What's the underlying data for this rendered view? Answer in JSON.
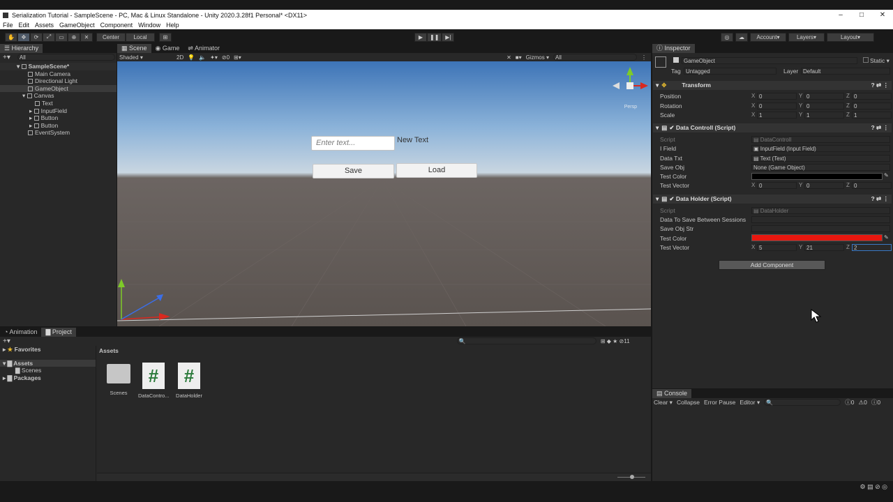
{
  "window": {
    "title": "Serialization Tutorial - SampleScene - PC, Mac & Linux Standalone - Unity 2020.3.28f1 Personal* <DX11>",
    "min": "–",
    "max": "□",
    "close": "✕"
  },
  "menu": [
    "File",
    "Edit",
    "Assets",
    "GameObject",
    "Component",
    "Window",
    "Help"
  ],
  "toolbar": {
    "center": "Center",
    "local": "Local",
    "account": "Account",
    "layers": "Layers",
    "layout": "Layout"
  },
  "hierarchy": {
    "tab": "Hierarchy",
    "search": "All",
    "scene": "SampleScene*",
    "items": [
      "Main Camera",
      "Directional Light",
      "GameObject",
      "Canvas",
      "Text",
      "InputField",
      "Button",
      "Button",
      "EventSystem"
    ]
  },
  "scene": {
    "tabs": [
      "Scene",
      "Game",
      "Animator"
    ],
    "shading": "Shaded",
    "mode2d": "2D",
    "hidden_count": "0",
    "gizmos": "Gizmos",
    "search": "All",
    "persp": "Persp",
    "input_placeholder": "Enter text...",
    "new_text": "New Text",
    "save": "Save",
    "load": "Load"
  },
  "inspector": {
    "tab": "Inspector",
    "object": "GameObject",
    "static": "Static",
    "tag_label": "Tag",
    "tag": "Untagged",
    "layer_label": "Layer",
    "layer": "Default",
    "transform": {
      "title": "Transform",
      "rows": [
        {
          "label": "Position",
          "x": "0",
          "y": "0",
          "z": "0"
        },
        {
          "label": "Rotation",
          "x": "0",
          "y": "0",
          "z": "0"
        },
        {
          "label": "Scale",
          "x": "1",
          "y": "1",
          "z": "1"
        }
      ]
    },
    "data_control": {
      "title": "Data Controll (Script)",
      "script_label": "Script",
      "script": "DataControll",
      "ifield_label": "I Field",
      "ifield": "InputField (Input Field)",
      "datatxt_label": "Data Txt",
      "datatxt": "Text (Text)",
      "saveobj_label": "Save Obj",
      "saveobj": "None (Game Object)",
      "color_label": "Test Color",
      "color": "#000000",
      "vec_label": "Test Vector",
      "x": "0",
      "y": "0",
      "z": "0"
    },
    "data_holder": {
      "title": "Data Holder (Script)",
      "script_label": "Script",
      "script": "DataHolder",
      "save_label": "Data To Save Between Sessions",
      "savestr_label": "Save Obj Str",
      "color_label": "Test Color",
      "color": "#e8170f",
      "vec_label": "Test Vector",
      "x": "5",
      "y": "21",
      "z": "2"
    },
    "add_component": "Add Component",
    "xl": "X",
    "yl": "Y",
    "zl": "Z"
  },
  "project": {
    "tabs": [
      "Animation",
      "Project"
    ],
    "favorites": "Favorites",
    "assets": "Assets",
    "scenes": "Scenes",
    "packages": "Packages",
    "breadcrumb": "Assets",
    "hidden_count": "11",
    "files": [
      {
        "name": "Scenes",
        "type": "folder"
      },
      {
        "name": "DataContro...",
        "type": "script"
      },
      {
        "name": "DataHolder",
        "type": "script"
      }
    ]
  },
  "console": {
    "tab": "Console",
    "clear": "Clear",
    "collapse": "Collapse",
    "error_pause": "Error Pause",
    "editor": "Editor",
    "counts": [
      "0",
      "0",
      "0"
    ]
  }
}
